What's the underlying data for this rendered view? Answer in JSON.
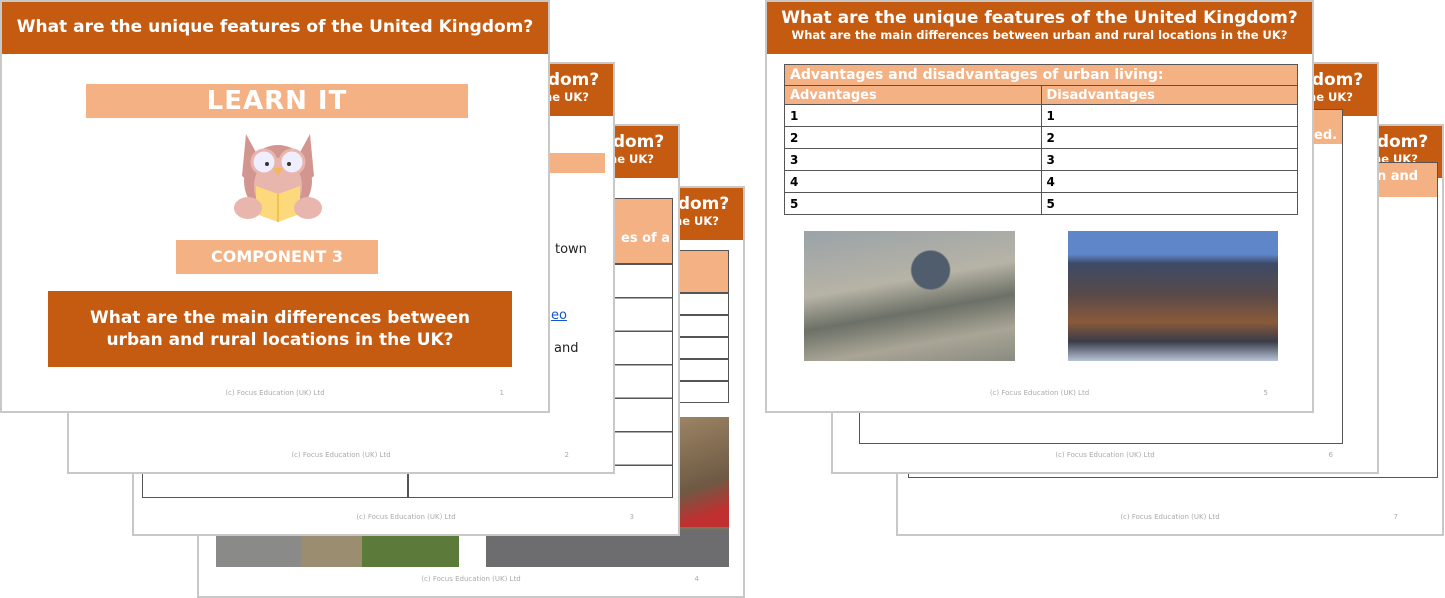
{
  "common": {
    "title": "What are the unique features of the United Kingdom?",
    "subtitle": "What are the main differences between urban and rural locations in the UK?",
    "footer": "(c) Focus Education (UK) Ltd"
  },
  "colors": {
    "header": "#c55a11",
    "peach": "#f4b183",
    "border": "#c8c8c8"
  },
  "slide1": {
    "banner": "LEARN IT",
    "icon": "owl-reading-book-icon",
    "component": "COMPONENT 3",
    "question": "What are the main differences between urban and rural locations in the UK?",
    "page": "1"
  },
  "slide2": {
    "fragments": [
      "town",
      "eo",
      "and"
    ],
    "page": "2"
  },
  "slide3": {
    "table_fragment": "es of a",
    "page": "3"
  },
  "slide4": {
    "page": "4"
  },
  "slide5": {
    "table_title": "Advantages and disadvantages of urban living:",
    "columns": [
      "Advantages",
      "Disadvantages"
    ],
    "rows": [
      [
        "1",
        "1"
      ],
      [
        "2",
        "2"
      ],
      [
        "3",
        "3"
      ],
      [
        "4",
        "4"
      ],
      [
        "5",
        "5"
      ]
    ],
    "page": "5"
  },
  "slide6": {
    "fragment": "ed.",
    "page": "6"
  },
  "slide7": {
    "fragment": "n and",
    "page": "7"
  }
}
